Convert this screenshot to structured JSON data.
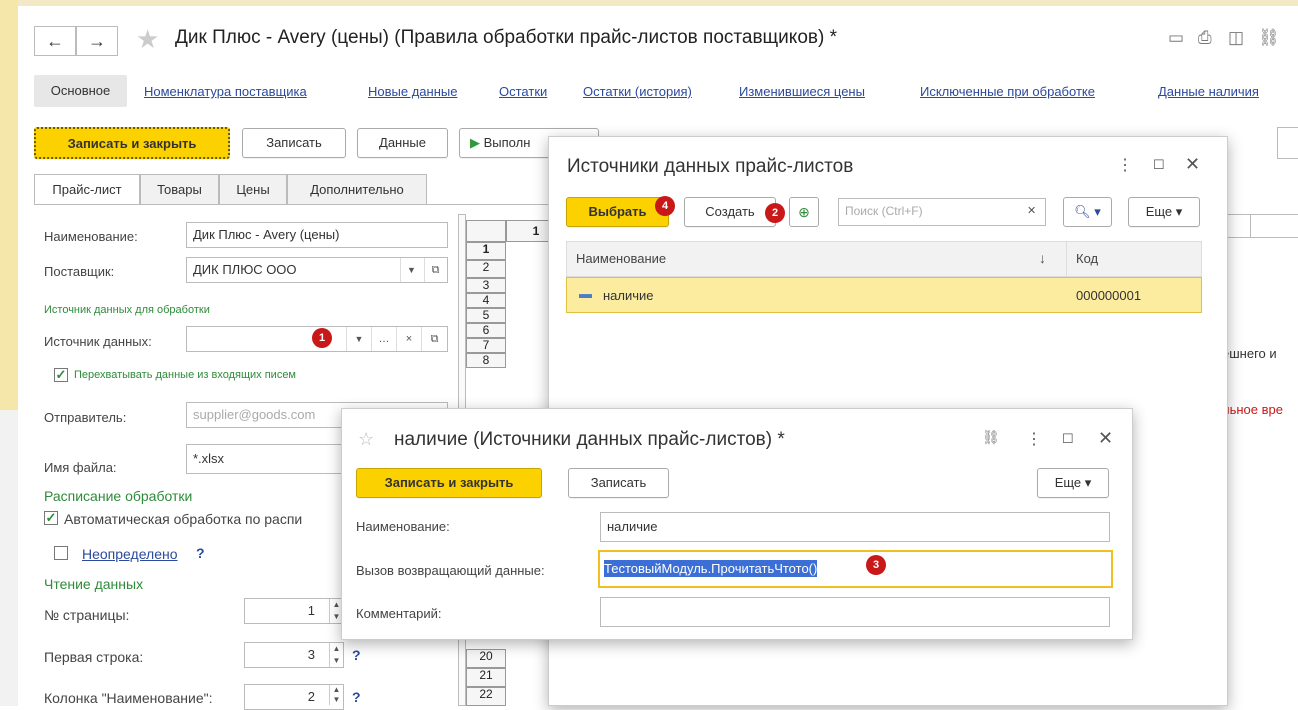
{
  "window": {
    "title": "Дик Плюс - Avery (цены) (Правила обработки прайс-листов поставщиков) *",
    "back_icon": "←",
    "forward_icon": "→"
  },
  "nav": {
    "active": "Основное",
    "links": [
      "Номенклатура поставщика",
      "Новые данные",
      "Остатки",
      "Остатки (история)",
      "Изменившиеся цены",
      "Исключенные при обработке",
      "Данные наличия"
    ]
  },
  "toolbar": {
    "save_close": "Записать и закрыть",
    "save": "Записать",
    "data": "Данные",
    "run": "Выполн"
  },
  "form_tabs": [
    "Прайс-лист",
    "Товары",
    "Цены",
    "Дополнительно"
  ],
  "form": {
    "name_label": "Наименование:",
    "name_value": "Дик Плюс - Avery (цены)",
    "supplier_label": "Поставщик:",
    "supplier_value": "ДИК ПЛЮС ООО",
    "source_group": "Источник данных для обработки",
    "source_label": "Источник данных:",
    "source_value": "",
    "intercept_label": "Перехватывать данные из входящих писем",
    "sender_label": "Отправитель:",
    "sender_value": "supplier@goods.com",
    "file_label": "Имя файла:",
    "file_value": "*.xlsx",
    "schedule_group": "Расписание обработки",
    "auto_label": "Автоматическая обработка по распи",
    "undefined_link": "Неопределено",
    "question": "?",
    "read_group": "Чтение данных",
    "page_label": "№ страницы:",
    "page_value": "1",
    "first_row_label": "Первая строка:",
    "first_row_value": "3",
    "col_name_label": "Колонка \"Наименование\":",
    "col_name_value": "2"
  },
  "grid": {
    "col_header": "1",
    "rows_top": [
      "1",
      "2",
      "3",
      "4",
      "5",
      "6",
      "7",
      "8"
    ],
    "rows_bottom": [
      "20",
      "21",
      "22"
    ]
  },
  "right_peek": {
    "text1": "ешнего и",
    "text2": "льное вре"
  },
  "badges": [
    "1",
    "2",
    "3",
    "4"
  ],
  "dialog1": {
    "title": "Источники данных прайс-листов",
    "select_btn": "Выбрать",
    "create_btn": "Создать",
    "search_placeholder": "Поиск (Ctrl+F)",
    "more_btn": "Еще",
    "col_name": "Наименование",
    "col_code": "Код",
    "sort_icon": "↓",
    "row_name": "наличие",
    "row_code": "000000001"
  },
  "dialog2": {
    "title": "наличие (Источники данных прайс-листов) *",
    "save_close": "Записать и закрыть",
    "save": "Записать",
    "more": "Еще",
    "name_label": "Наименование:",
    "name_value": "наличие",
    "call_label": "Вызов возвращающий данные:",
    "call_value": "ТестовыйМодуль.ПрочитатьЧтото()",
    "comment_label": "Комментарий:",
    "comment_value": ""
  },
  "colors": {
    "accent_yellow": "#fcd100",
    "link_blue": "#2b4a9b",
    "green": "#2e8b3a",
    "badge_red": "#c81818",
    "selection_blue": "#3b6fd6"
  }
}
